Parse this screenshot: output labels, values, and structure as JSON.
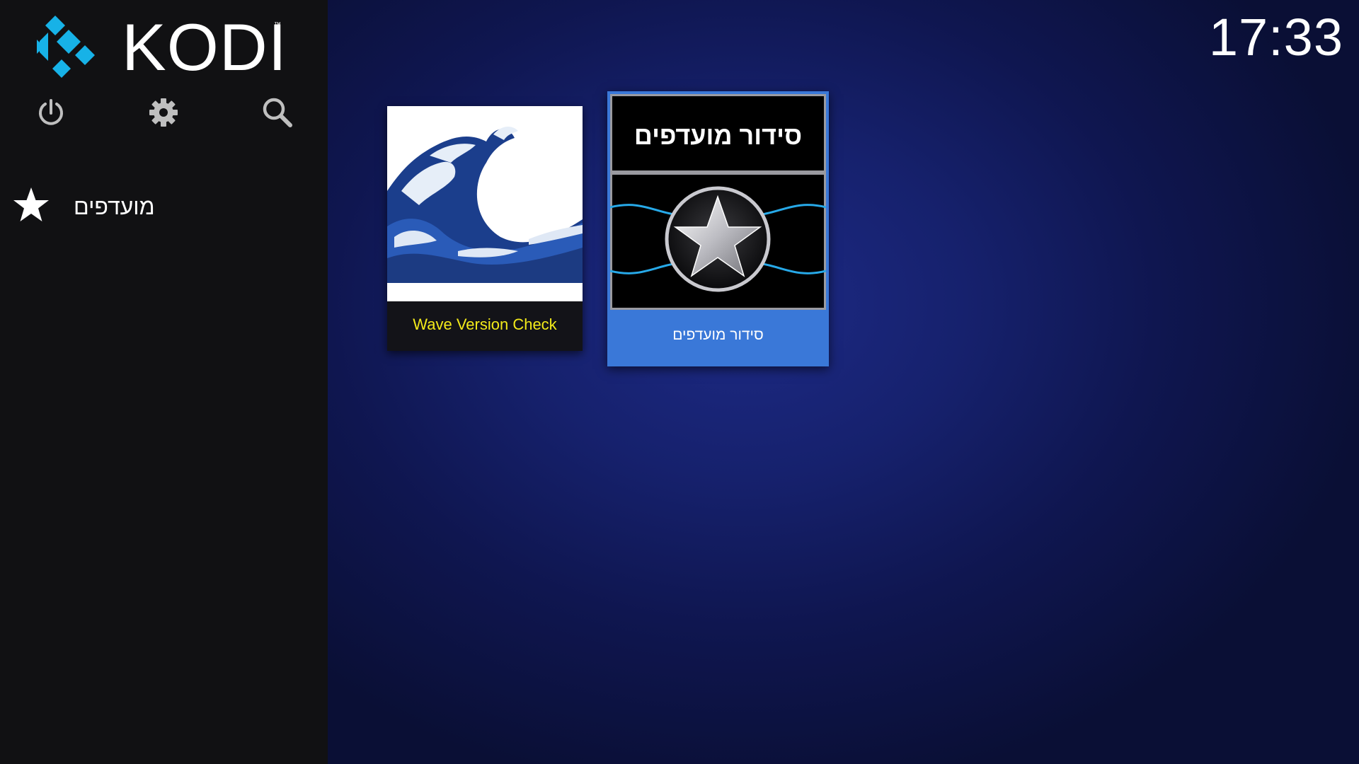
{
  "app": {
    "name": "KODI",
    "trademark": "™"
  },
  "clock": {
    "time": "17:33"
  },
  "toolbar": {
    "items": [
      {
        "name": "power",
        "icon": "power-icon"
      },
      {
        "name": "settings",
        "icon": "gear-icon"
      },
      {
        "name": "search",
        "icon": "search-icon"
      }
    ]
  },
  "sidebar": {
    "items": [
      {
        "label": "מועדפים",
        "icon": "star-icon"
      }
    ]
  },
  "favourites": [
    {
      "caption": "Wave Version Check",
      "thumbnail": "wave-image",
      "caption_color": "#f3ea1a"
    },
    {
      "caption": "סידור מועדפים",
      "thumbnail_title": "סידור מועדפים",
      "thumbnail": "star-emblem-image",
      "focused": true
    }
  ],
  "colors": {
    "brand_blue": "#17b2e7",
    "focus_blue": "#3a78d8",
    "sidebar_bg": "#111113"
  }
}
